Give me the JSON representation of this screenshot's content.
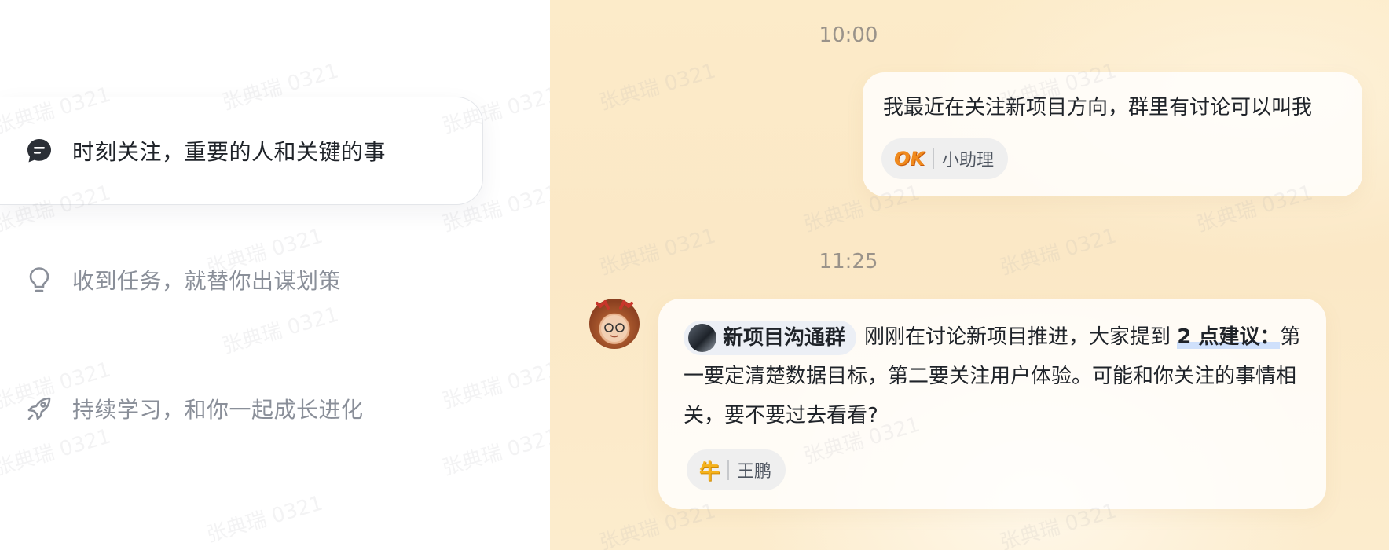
{
  "features": [
    {
      "label": "时刻关注，重要的人和关键的事",
      "icon": "chat-bubble-icon",
      "active": true
    },
    {
      "label": "收到任务，就替你出谋划策",
      "icon": "lightbulb-icon",
      "active": false
    },
    {
      "label": "持续学习，和你一起成长进化",
      "icon": "rocket-icon",
      "active": false
    }
  ],
  "chat": {
    "time1": "10:00",
    "message1": {
      "text": "我最近在关注新项目方向，群里有讨论可以叫我",
      "reaction": {
        "emoji": "OK",
        "name": "小助理"
      }
    },
    "time2": "11:25",
    "message2": {
      "group_tag": "新项目沟通群",
      "text_before": "刚刚在讨论新项目推进，大家提到",
      "highlight": "2 点建议：",
      "text_after": "第一要定清楚数据目标，第二要关注用户体验。可能和你关注的事情相关，要不要过去看看?",
      "reaction": {
        "emoji": "牛",
        "name": "王鹏"
      }
    }
  },
  "watermark": "张典瑞 0321",
  "colors": {
    "chat_bg": "#fbe8c6",
    "active_text": "#1f2329",
    "dim_text": "#8a8f99",
    "highlight": "#cfe0fb"
  }
}
